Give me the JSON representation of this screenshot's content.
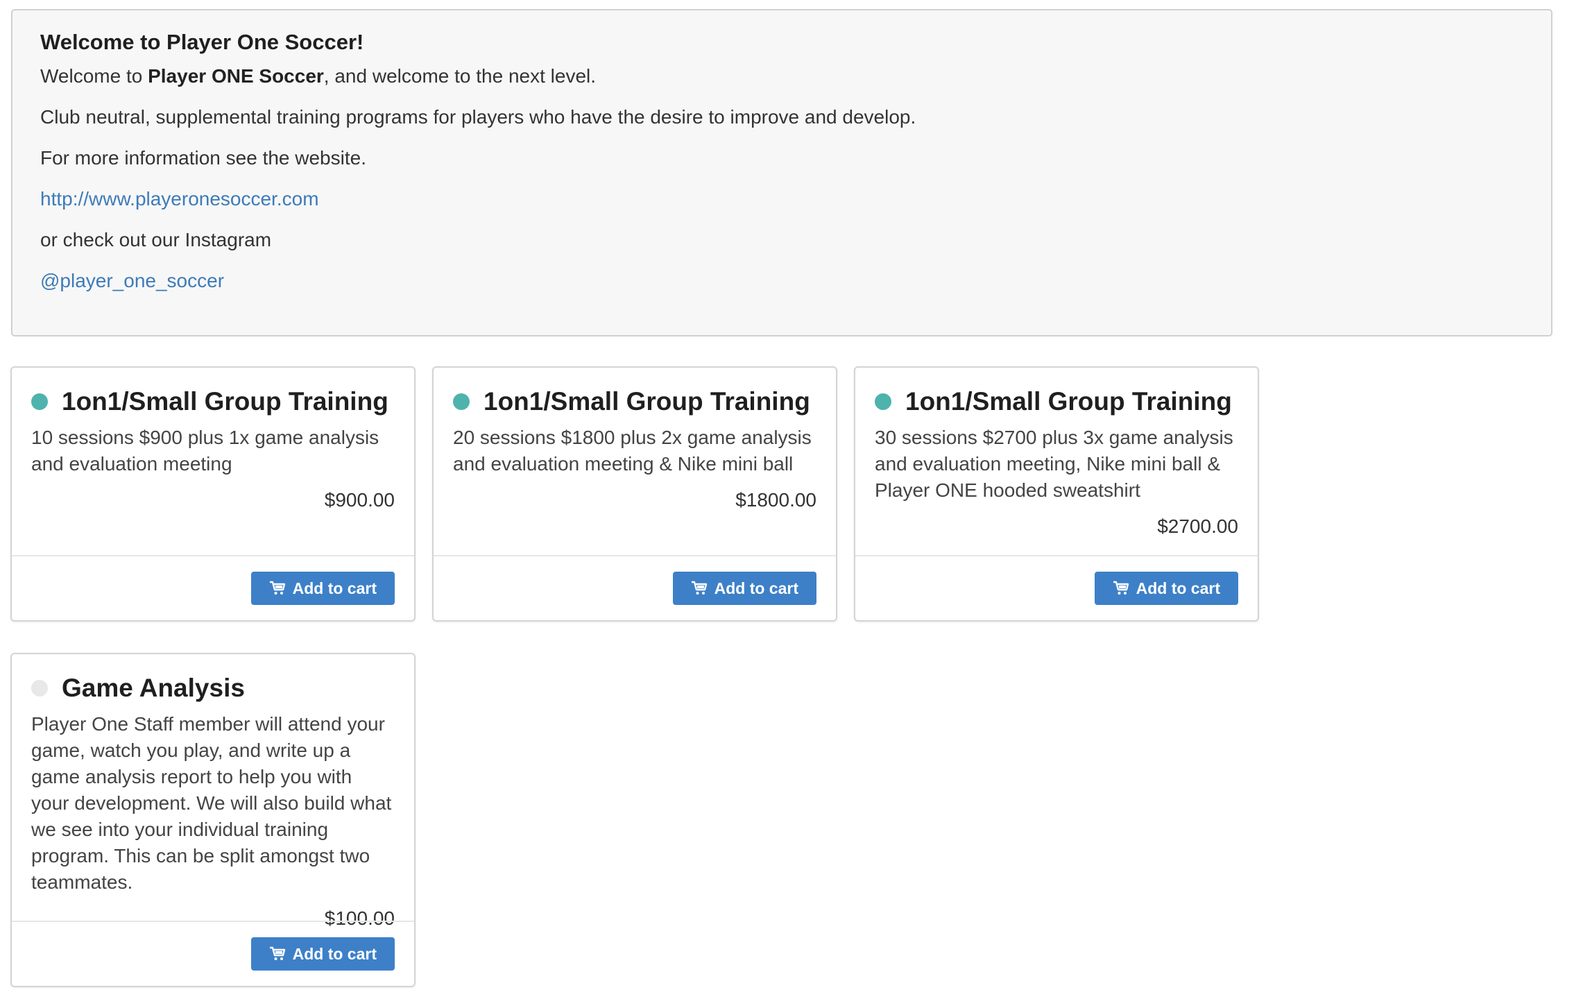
{
  "welcome": {
    "heading": "Welcome to Player One Soccer!",
    "line1_prefix": "Welcome to ",
    "line1_bold": "Player ONE Soccer",
    "line1_suffix": ", and welcome to the next level.",
    "line2": "Club neutral, supplemental training programs for players who have the desire to improve and develop.",
    "line3": "For more information see the website.",
    "website_link": "http://www.playeronesoccer.com",
    "line4": "or check out our Instagram",
    "instagram_link": "@player_one_soccer"
  },
  "colors": {
    "accent": "#3d80c8",
    "link": "#3d7bb8",
    "available_dot": "#4db3ac",
    "unavailable_dot": "#e8e8e8"
  },
  "products": [
    {
      "title": "1on1/Small Group Training",
      "description": "10 sessions $900 plus 1x game analysis and evaluation meeting",
      "price": "$900.00",
      "button_label": "Add to cart",
      "button_icon": "cart-icon",
      "status": "available"
    },
    {
      "title": "1on1/Small Group Training",
      "description": "20 sessions $1800 plus 2x game analysis and evaluation meeting & Nike mini ball",
      "price": "$1800.00",
      "button_label": "Add to cart",
      "button_icon": "cart-icon",
      "status": "available"
    },
    {
      "title": "1on1/Small Group Training",
      "description": "30 sessions $2700 plus 3x game analysis and evaluation meeting, Nike mini ball & Player ONE hooded sweatshirt",
      "price": "$2700.00",
      "button_label": "Add to cart",
      "button_icon": "cart-icon",
      "status": "available"
    },
    {
      "title": "Game Analysis",
      "description": "Player One Staff member will attend your game, watch you play, and write up a game analysis report to help you with your development. We will also build what we see into your individual training program. This can be split amongst two teammates.",
      "price": "$100.00",
      "button_label": "Add to cart",
      "button_icon": "cart-icon",
      "status": "unavailable"
    }
  ]
}
